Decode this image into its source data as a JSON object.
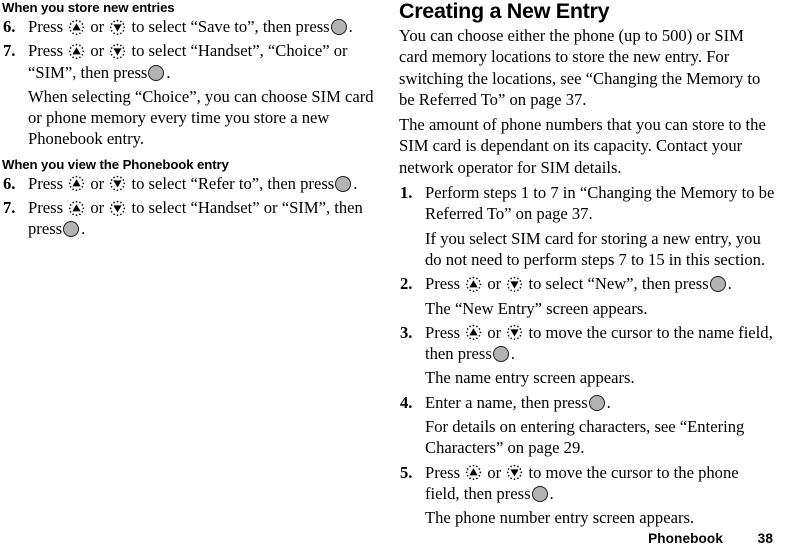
{
  "page": {
    "number": "38",
    "chapter": "Phonebook"
  },
  "left_column": {
    "heading_1": "When you store new entries",
    "step_6": {
      "num": "6.",
      "part_a": "Press",
      "part_b": "or",
      "part_c": "to select “Save to”, then press",
      "part_d": "."
    },
    "step_7": {
      "num": "7.",
      "part_a": "Press",
      "part_b": "or",
      "part_c": "to select “Handset”, “Choice” or “SIM”, then press",
      "part_d": "."
    },
    "note_1": "When selecting “Choice”, you can choose SIM card or phone memory every time you store a new Phonebook entry.",
    "heading_2": "When you view the Phonebook entry",
    "step_6b": {
      "num": "6.",
      "part_a": "Press",
      "part_b": "or",
      "part_c": "to select “Refer to”, then press",
      "part_d": "."
    },
    "step_7b": {
      "num": "7.",
      "part_a": "Press",
      "part_b": "or",
      "part_c": "to select “Handset” or “SIM”, then press",
      "part_d": "."
    }
  },
  "right_column": {
    "title": "Creating a New Entry",
    "intro_1": "You can choose either the phone (up to 500) or SIM card memory locations to store the new entry. For switching the locations, see “Changing the Memory to be Referred To” on page 37.",
    "intro_2": "The amount of phone numbers that you can store to the SIM card is dependant on its capacity. Contact your network operator for SIM details.",
    "step_1": {
      "num": "1.",
      "text": "Perform steps 1 to 7 in “Changing the Memory to be Referred To” on page 37."
    },
    "note_1": "If you select SIM card for storing a new entry, you do not need to perform steps 7 to 15 in this section.",
    "step_2": {
      "num": "2.",
      "part_a": "Press",
      "part_b": "or",
      "part_c": "to select “New”, then press",
      "part_d": "."
    },
    "note_2": "The “New Entry” screen appears.",
    "step_3": {
      "num": "3.",
      "part_a": "Press",
      "part_b": "or",
      "part_c": "to move the cursor to the name field, then press",
      "part_d": "."
    },
    "note_3": "The name entry screen appears.",
    "step_4": {
      "num": "4.",
      "part_a": "Enter a name, then press",
      "part_d": "."
    },
    "note_4": "For details on entering characters, see “Entering Characters” on page 29.",
    "step_5": {
      "num": "5.",
      "part_a": "Press",
      "part_b": "or",
      "part_c": "to move the cursor to the phone field, then press",
      "part_d": "."
    },
    "note_5": "The phone number entry screen appears."
  },
  "icons": {
    "up_key": "up-arrow-key-icon",
    "down_key": "down-arrow-key-icon",
    "center_key": "center-select-key-icon"
  },
  "colors": {
    "text": "#000000",
    "key_fill": "#b3b3b3",
    "key_stroke": "#1a1a1a",
    "background": "#ffffff"
  }
}
